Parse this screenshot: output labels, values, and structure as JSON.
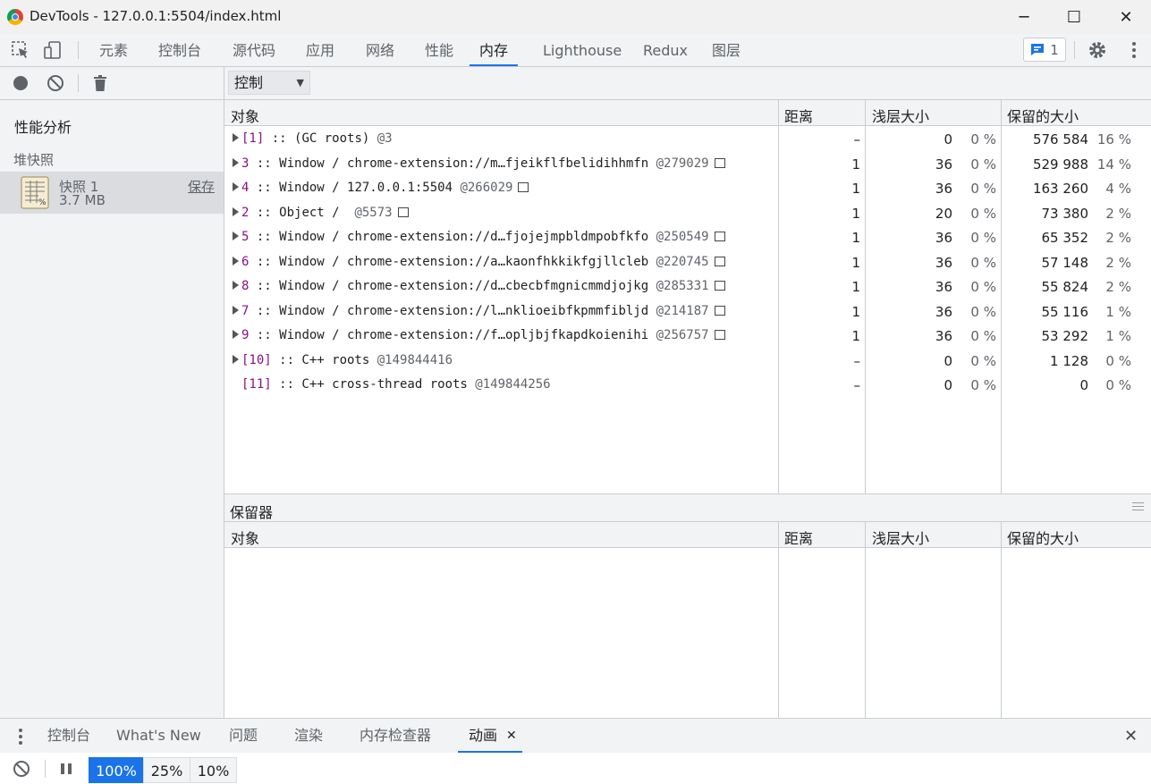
{
  "window": {
    "title": "DevTools - 127.0.0.1:5504/index.html",
    "minimize": "─",
    "maximize": "☐",
    "close": "✕"
  },
  "tabs": [
    "元素",
    "控制台",
    "源代码",
    "应用",
    "网络",
    "性能",
    "内存",
    "Lighthouse",
    "Redux",
    "图层"
  ],
  "active_tab": "内存",
  "issues": {
    "count": "1"
  },
  "sidebar": {
    "section_profiles": "性能分析",
    "section_heap": "堆快照",
    "snapshot": {
      "name": "快照 1",
      "size": "3.7 MB",
      "save_label": "保存"
    }
  },
  "view_select": {
    "value": "控制",
    "arrow": "▼"
  },
  "columns": {
    "object": "对象",
    "distance": "距离",
    "shallow": "浅层大小",
    "retained": "保留的大小"
  },
  "rows": [
    {
      "label": "[1]",
      "desc": " :: (GC roots) ",
      "id": "@3",
      "box": false,
      "expand": true,
      "distance": "–",
      "shallow": "0",
      "shallow_pct": "0 %",
      "retained": "576 584",
      "retained_pct": "16 %"
    },
    {
      "label": "3",
      "desc": " :: Window / chrome-extension://m…fjeikflfbelidihhmfn ",
      "id": "@279029",
      "box": true,
      "expand": true,
      "distance": "1",
      "shallow": "36",
      "shallow_pct": "0 %",
      "retained": "529 988",
      "retained_pct": "14 %"
    },
    {
      "label": "4",
      "desc": " :: Window / 127.0.0.1:5504 ",
      "id": "@266029",
      "box": true,
      "expand": true,
      "distance": "1",
      "shallow": "36",
      "shallow_pct": "0 %",
      "retained": "163 260",
      "retained_pct": "4 %"
    },
    {
      "label": "2",
      "desc": " :: Object /  ",
      "id": "@5573",
      "box": true,
      "expand": true,
      "distance": "1",
      "shallow": "20",
      "shallow_pct": "0 %",
      "retained": "73 380",
      "retained_pct": "2 %"
    },
    {
      "label": "5",
      "desc": " :: Window / chrome-extension://d…fjojejmpbldmpobfkfo ",
      "id": "@250549",
      "box": true,
      "expand": true,
      "distance": "1",
      "shallow": "36",
      "shallow_pct": "0 %",
      "retained": "65 352",
      "retained_pct": "2 %"
    },
    {
      "label": "6",
      "desc": " :: Window / chrome-extension://a…kaonfhkkikfgjllcleb ",
      "id": "@220745",
      "box": true,
      "expand": true,
      "distance": "1",
      "shallow": "36",
      "shallow_pct": "0 %",
      "retained": "57 148",
      "retained_pct": "2 %"
    },
    {
      "label": "8",
      "desc": " :: Window / chrome-extension://d…cbecbfmgnicmmdjojkg ",
      "id": "@285331",
      "box": true,
      "expand": true,
      "distance": "1",
      "shallow": "36",
      "shallow_pct": "0 %",
      "retained": "55 824",
      "retained_pct": "2 %"
    },
    {
      "label": "7",
      "desc": " :: Window / chrome-extension://l…nklioeibfkpmmfibljd ",
      "id": "@214187",
      "box": true,
      "expand": true,
      "distance": "1",
      "shallow": "36",
      "shallow_pct": "0 %",
      "retained": "55 116",
      "retained_pct": "1 %"
    },
    {
      "label": "9",
      "desc": " :: Window / chrome-extension://f…opljbjfkapdkoienihi ",
      "id": "@256757",
      "box": true,
      "expand": true,
      "distance": "1",
      "shallow": "36",
      "shallow_pct": "0 %",
      "retained": "53 292",
      "retained_pct": "1 %"
    },
    {
      "label": "[10]",
      "desc": " :: C++ roots ",
      "id": "@149844416",
      "box": false,
      "expand": true,
      "distance": "–",
      "shallow": "0",
      "shallow_pct": "0 %",
      "retained": "1 128",
      "retained_pct": "0 %"
    },
    {
      "label": "[11]",
      "desc": " :: C++ cross-thread roots ",
      "id": "@149844256",
      "box": false,
      "expand": false,
      "distance": "–",
      "shallow": "0",
      "shallow_pct": "0 %",
      "retained": "0",
      "retained_pct": "0 %"
    }
  ],
  "retainers": {
    "title": "保留器"
  },
  "drawer": {
    "tabs": [
      "控制台",
      "What's New",
      "问题",
      "渲染",
      "内存检查器",
      "动画"
    ],
    "active_tab": "动画",
    "tab_close": "✕",
    "close": "✕"
  },
  "animation": {
    "speeds": [
      "100%",
      "25%",
      "10%"
    ],
    "active_speed": "100%"
  },
  "colors": {
    "accent": "#1a73e8",
    "object_id": "#881280"
  }
}
